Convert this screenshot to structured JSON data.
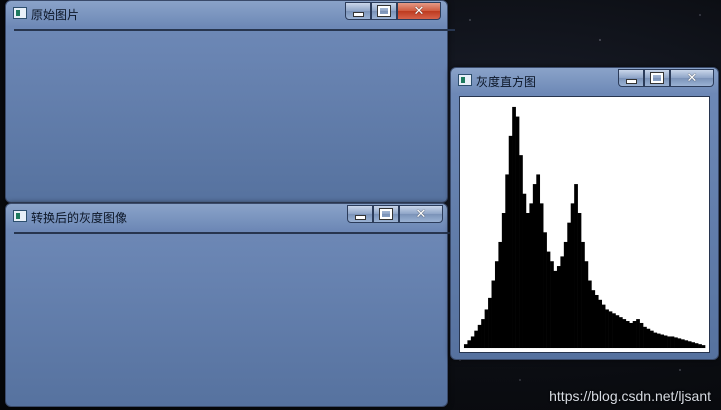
{
  "windows": {
    "original": {
      "title": "原始图片"
    },
    "gray": {
      "title": "转换后的灰度图像"
    },
    "histogram": {
      "title": "灰度直方图"
    }
  },
  "controls": {
    "min": "",
    "max": "",
    "close": "✕"
  },
  "histogram": {
    "bins": [
      4,
      8,
      12,
      18,
      24,
      30,
      40,
      52,
      70,
      90,
      110,
      140,
      180,
      220,
      250,
      240,
      200,
      160,
      140,
      150,
      170,
      180,
      150,
      120,
      100,
      90,
      80,
      85,
      95,
      110,
      130,
      150,
      170,
      140,
      110,
      90,
      70,
      60,
      55,
      50,
      45,
      40,
      38,
      36,
      34,
      32,
      30,
      28,
      26,
      28,
      30,
      26,
      22,
      20,
      18,
      16,
      15,
      14,
      13,
      12,
      12,
      11,
      10,
      9,
      8,
      7,
      6,
      5,
      4,
      3
    ]
  },
  "watermark": "https://blog.csdn.net/ljsant"
}
